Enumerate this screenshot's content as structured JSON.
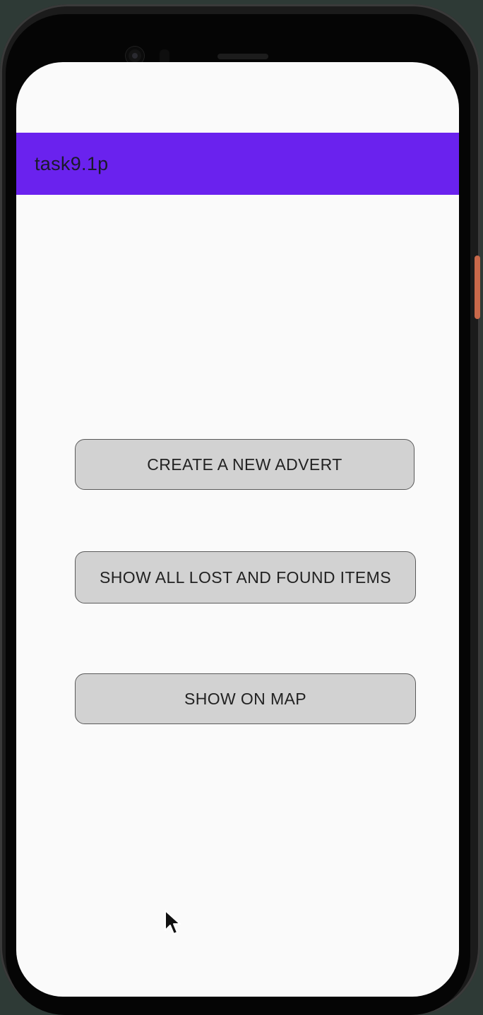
{
  "app_bar": {
    "title": "task9.1p",
    "color": "#6a22ee"
  },
  "buttons": {
    "create_advert": "CREATE A NEW ADVERT",
    "show_all_items": "SHOW ALL LOST AND FOUND ITEMS",
    "show_on_map": "SHOW ON MAP"
  },
  "icons": {
    "front_camera": "camera-icon",
    "mouse_cursor": "cursor-icon"
  }
}
